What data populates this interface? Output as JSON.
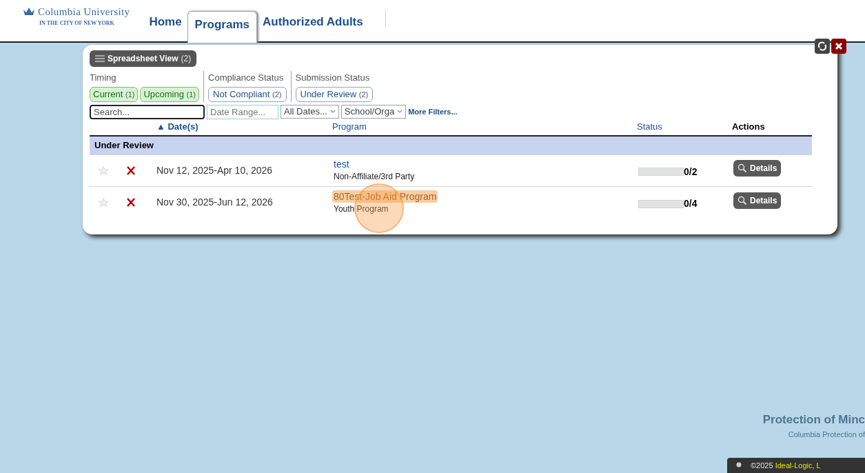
{
  "logo": {
    "name": "Columbia University",
    "tagline": "IN THE CITY OF NEW YORK"
  },
  "tabs": [
    {
      "label": "Home",
      "selected": false
    },
    {
      "label": "Programs",
      "selected": true
    },
    {
      "label": "Authorized Adults",
      "selected": false
    }
  ],
  "spreadsheet_button": {
    "label": "Spreadsheet View",
    "count": "(2)"
  },
  "filter_groups": [
    {
      "title": "Timing",
      "chips": [
        {
          "label": "Current",
          "count": "(1)",
          "kind": "timing"
        },
        {
          "label": "Upcoming",
          "count": "(1)",
          "kind": "timing"
        }
      ]
    },
    {
      "title": "Compliance Status",
      "chips": [
        {
          "label": "Not Compliant",
          "count": "(2)",
          "kind": "status"
        }
      ]
    },
    {
      "title": "Submission Status",
      "chips": [
        {
          "label": "Under Review",
          "count": "(2)",
          "kind": "status"
        }
      ]
    }
  ],
  "filters": {
    "search_placeholder": "Search...",
    "date_range_placeholder": "Date Range...",
    "dates_select": "All Dates...",
    "school_select": "School/Orga",
    "more_filters": "More Filters..."
  },
  "table": {
    "columns": [
      "▲ Date(s)",
      "Program",
      "Status",
      "Actions"
    ],
    "group": "Under Review",
    "rows": [
      {
        "dates": "Nov 12, 2025-Apr 10, 2026",
        "program": "test",
        "program_type": "Non-Affiliate/3rd Party",
        "level": 0,
        "progress": "0/2",
        "action": "Details",
        "highlighted": false
      },
      {
        "dates": "Nov 30, 2025-Jun 12, 2026",
        "program": "80Test-Job Aid Program",
        "program_type": "Youth Program",
        "level": 0,
        "progress": "0/4",
        "action": "Details",
        "highlighted": true
      }
    ]
  },
  "footer": {
    "title": "Protection of Minc",
    "subtitle": "Columbia Protection of",
    "copyright": "©2025",
    "company": "Ideal-Logic, L"
  }
}
